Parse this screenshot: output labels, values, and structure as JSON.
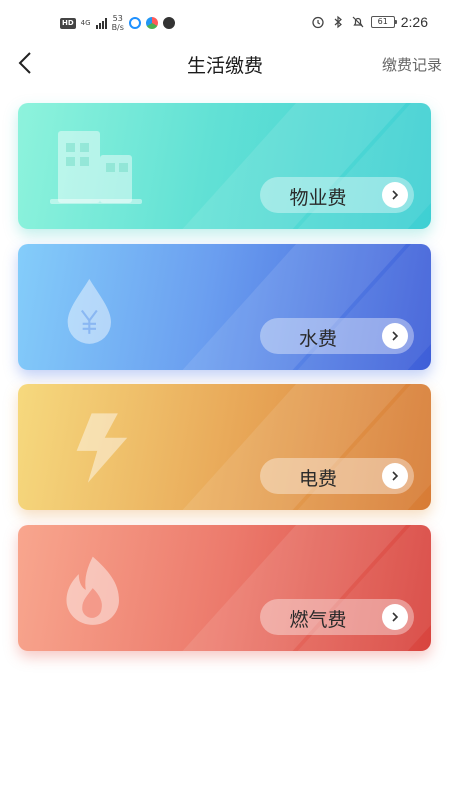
{
  "status_bar": {
    "hd": "HD",
    "network": "4G",
    "speed_value": "53",
    "speed_unit": "B/s",
    "battery": "61",
    "time": "2:26"
  },
  "header": {
    "title": "生活缴费",
    "records": "缴费记录"
  },
  "cards": [
    {
      "label": "物业费",
      "icon": "building-icon"
    },
    {
      "label": "水费",
      "icon": "water-drop-yuan-icon"
    },
    {
      "label": "电费",
      "icon": "lightning-icon"
    },
    {
      "label": "燃气费",
      "icon": "flame-icon"
    }
  ],
  "colors": {
    "property": "#4fd8d4",
    "water": "#5582e6",
    "electric": "#e49a4c",
    "gas": "#e45a50"
  }
}
